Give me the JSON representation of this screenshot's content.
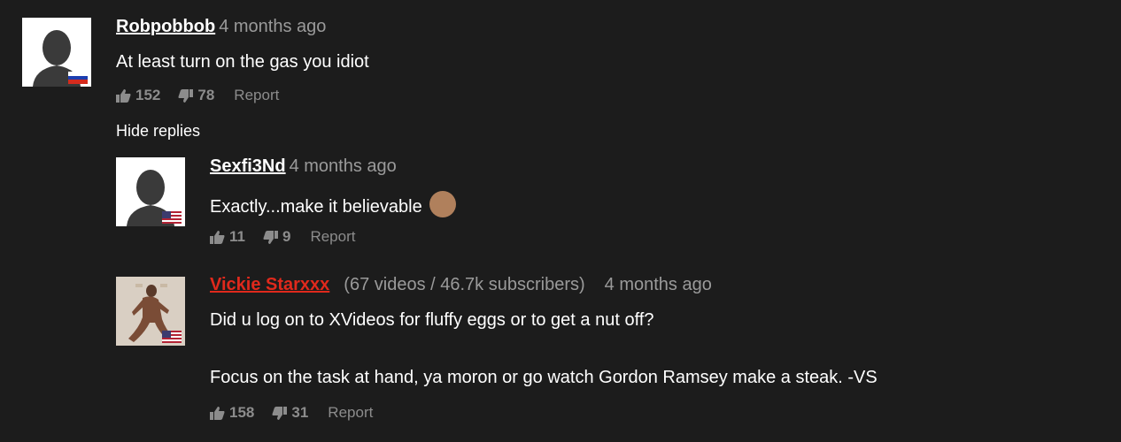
{
  "comments": [
    {
      "username": "Robpobbob",
      "time": "4 months ago",
      "text": "At least turn on the gas you idiot",
      "likes": "152",
      "dislikes": "78",
      "report": "Report",
      "flag": "russia"
    }
  ],
  "hide_replies": "Hide replies",
  "replies": [
    {
      "username": "Sexfi3Nd",
      "time": "4 months ago",
      "text": "Exactly...make it believable",
      "likes": "11",
      "dislikes": "9",
      "report": "Report",
      "flag": "usa"
    },
    {
      "username": "Vickie Starxxx",
      "meta": "(67 videos / 46.7k subscribers)",
      "time": "4 months ago",
      "text_line1": "Did u log on to XVideos for fluffy eggs or to get a nut off?",
      "text_line2": "Focus on the task at hand, ya moron or go watch Gordon Ramsey make a steak. -VS",
      "likes": "158",
      "dislikes": "31",
      "report": "Report",
      "flag": "usa",
      "name_color": "#e0291c"
    }
  ],
  "colors": {
    "background": "#1c1c1c",
    "muted": "#9a9a9a",
    "accent_red": "#e0291c"
  },
  "icons": {
    "like": "thumbs-up-icon",
    "dislike": "thumbs-down-icon"
  }
}
